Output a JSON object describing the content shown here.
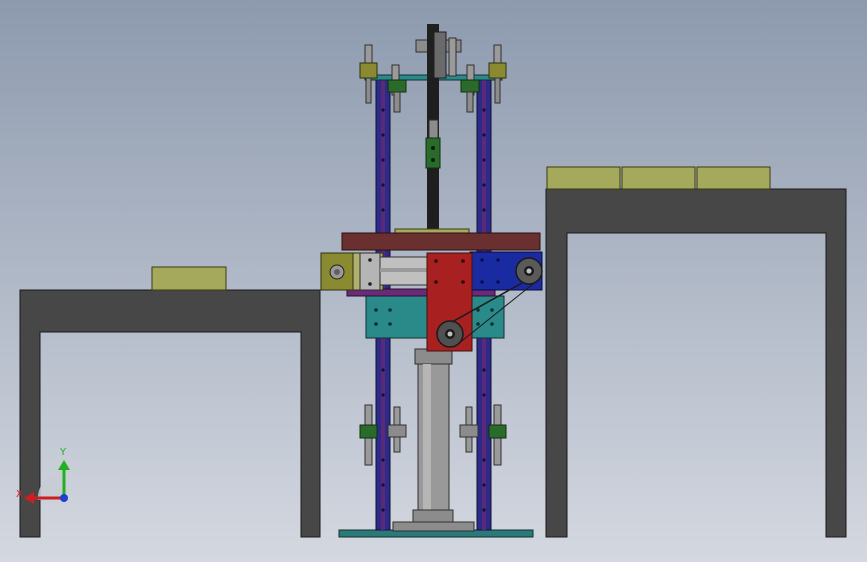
{
  "colors": {
    "background_top": "#8d9aae",
    "background_bottom": "#d4d8e0",
    "table_frame": "#4a4a4a",
    "box": "#a3a85a",
    "column": "#2d2a8a",
    "column_stripe": "#5a2a7a",
    "platform": "#6a3030",
    "carriage_red": "#a82020",
    "carriage_blue": "#1a2aa0",
    "teal": "#2a8a8a",
    "cylinder": "#8a8a8a",
    "olive": "#8a8a30",
    "green": "#2a6a2a",
    "belt": "#202020",
    "axis_x": "#cc2020",
    "axis_y": "#20b020",
    "axis_z": "#2040d0"
  },
  "view_triad": {
    "x_label": "X",
    "y_label": "Y"
  },
  "icons": {
    "triad": "coordinate-triad-icon"
  }
}
